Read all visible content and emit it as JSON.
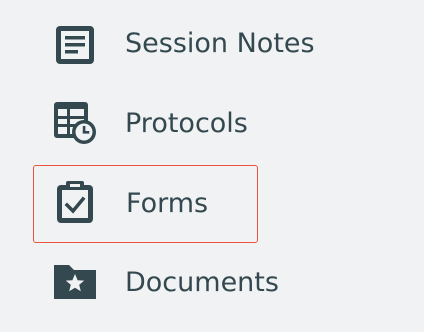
{
  "sidebar": {
    "items": [
      {
        "label": "Session Notes",
        "icon": "session-notes-icon",
        "selected": false
      },
      {
        "label": "Protocols",
        "icon": "protocols-icon",
        "selected": false
      },
      {
        "label": "Forms",
        "icon": "forms-clipboard-check-icon",
        "selected": true
      },
      {
        "label": "Documents",
        "icon": "documents-folder-star-icon",
        "selected": false
      }
    ]
  },
  "colors": {
    "icon_and_text": "#33494f",
    "background": "#f1f2f4",
    "selection_outline": "#e8553b"
  }
}
